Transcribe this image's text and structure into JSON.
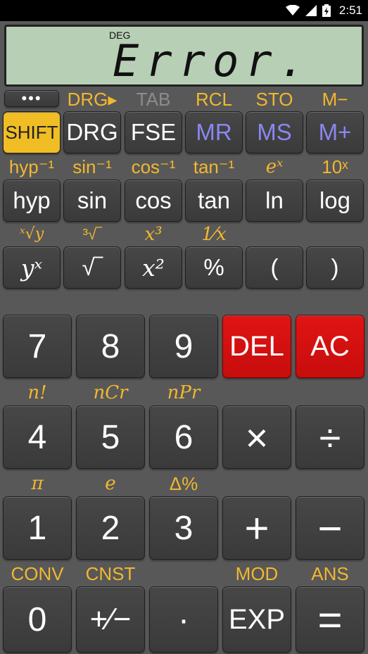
{
  "status_bar": {
    "time": "2:51"
  },
  "display": {
    "angle_mode": "DEG",
    "result": "Error."
  },
  "row_menu": {
    "menu_button": "•••",
    "labels": [
      "DRG▸",
      "TAB",
      "RCL",
      "STO",
      "M−"
    ]
  },
  "row1": [
    "SHIFT",
    "DRG",
    "FSE",
    "MR",
    "MS",
    "M+"
  ],
  "row2_labels": [
    "hyp⁻¹",
    "sin⁻¹",
    "cos⁻¹",
    "tan⁻¹",
    "eˣ",
    "10ˣ"
  ],
  "row2": [
    "hyp",
    "sin",
    "cos",
    "tan",
    "ln",
    "log"
  ],
  "row3_labels": [
    "ˣ√y",
    "³√‾",
    "x³",
    "1⁄x"
  ],
  "row3": [
    "yˣ",
    "√‾",
    "x²",
    "%",
    "(",
    ")"
  ],
  "numpad": {
    "row_a": [
      "7",
      "8",
      "9",
      "DEL",
      "AC"
    ],
    "labels_b": [
      "n!",
      "nCr",
      "nPr"
    ],
    "row_b": [
      "4",
      "5",
      "6",
      "×",
      "÷"
    ],
    "labels_c": [
      "π",
      "e",
      "Δ%"
    ],
    "row_c": [
      "1",
      "2",
      "3",
      "+",
      "−"
    ],
    "labels_d": [
      "CONV",
      "CNST",
      "MOD",
      "ANS"
    ],
    "row_d": [
      "0",
      "+⁄−",
      "·",
      "EXP",
      "="
    ]
  },
  "colors": {
    "shift": "#f0be24",
    "secondary_label": "#f2b72f",
    "memory": "#8a87f1",
    "danger": "#d01010",
    "lcd": "#b7cfb5"
  }
}
